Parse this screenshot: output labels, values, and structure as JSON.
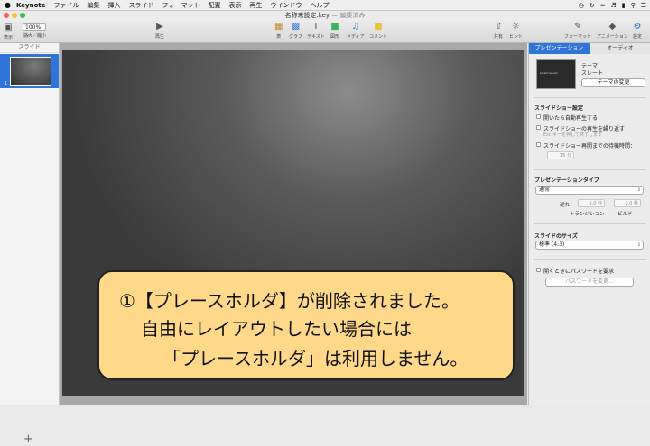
{
  "menubar": {
    "app": "Keynote",
    "items": [
      "ファイル",
      "編集",
      "挿入",
      "スライド",
      "フォーマット",
      "配置",
      "表示",
      "再生",
      "ウインドウ",
      "ヘルプ"
    ],
    "status_icons": [
      "clock-icon",
      "sync-icon",
      "wifi-icon",
      "volume-icon",
      "battery-icon",
      "spotlight-icon",
      "list-icon"
    ]
  },
  "window": {
    "title": "名称未設定.key",
    "subtitle": "— 編集済み"
  },
  "toolbar": {
    "view": "表示",
    "zoom_value": "100%",
    "zoom": "拡大／縮小",
    "play": "再生",
    "table": "表",
    "chart": "グラフ",
    "text": "テキスト",
    "shape": "図形",
    "media": "メディア",
    "comment": "コメント",
    "share": "共有",
    "tips": "ヒント",
    "format": "フォーマット",
    "animate": "アニメーション",
    "setup": "設定"
  },
  "sidebar": {
    "header": "スライド",
    "slide_number": "1",
    "add": "+"
  },
  "callout": {
    "line1": "①【プレースホルダ】が削除されました。",
    "line2": "自由にレイアウトしたい場合には",
    "line3": "「プレースホルダ」は利用しません。"
  },
  "inspector": {
    "tab_presentation": "プレゼンテーション",
    "tab_audio": "オーディオ",
    "theme_label": "テーマ",
    "theme_name": "スレート",
    "change_theme": "テーマの変更",
    "show_settings": "スライドショー設定",
    "auto_play": "開いたら自動再生する",
    "loop": "スライドショーの再生を繰り返す",
    "loop_hint": "Esc キーを押して終了します",
    "restart_idle": "スライドショー再開までの待機時間：",
    "idle_value": "15 分",
    "pres_type": "プレゼンテーションタイプ",
    "pres_type_value": "通常",
    "delay": "遅れ：",
    "transition_value": "5.0 秒",
    "build_value": "2.0 秒",
    "transition": "トランジション",
    "build": "ビルド",
    "slide_size": "スライドのサイズ",
    "slide_size_value": "標準 (4:3)",
    "password_req": "開くときにパスワードを要求",
    "change_password": "パスワードを変更..."
  },
  "colors": {
    "accent": "#2f75d9",
    "callout_fill": "#ffd88a",
    "slide_bg": "#4a4a4a"
  }
}
